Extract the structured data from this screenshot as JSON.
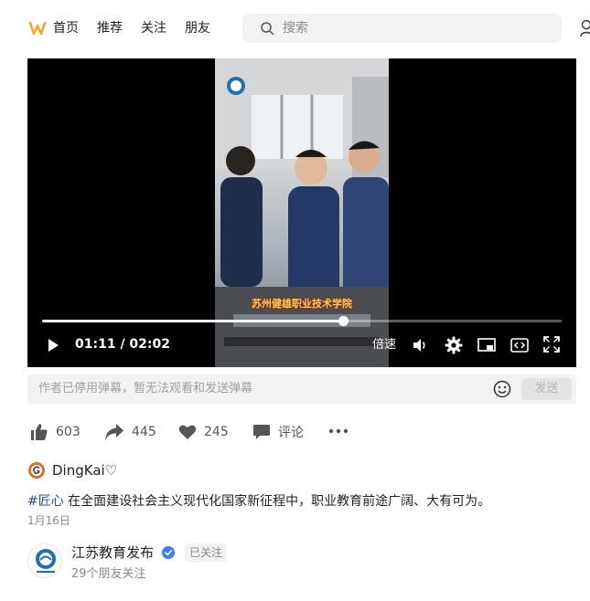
{
  "nav": {
    "items": [
      {
        "label": "首页"
      },
      {
        "label": "推荐"
      },
      {
        "label": "关注"
      },
      {
        "label": "朋友"
      }
    ],
    "search_placeholder": "搜索"
  },
  "player": {
    "subtitle": "苏州健雄职业技术学院",
    "current_time": "01:11",
    "total_time": "02:02",
    "time_display": "01:11 / 02:02",
    "progress": 0.58,
    "speed_label": "倍速"
  },
  "danmaku": {
    "notice": "作者已停用弹幕，暂无法观看和发送弹幕",
    "send_label": "发送"
  },
  "actions": {
    "likes": "603",
    "shares": "445",
    "favorites": "245",
    "comment_label": "评论"
  },
  "author": {
    "name": "DingKai♡"
  },
  "post": {
    "hashtag": "#匠心",
    "text": " 在全面建设社会主义现代化国家新征程中，职业教育前途广阔、大有可为。",
    "date": "1月16日"
  },
  "account": {
    "name": "江苏教育发布",
    "follow_status": "已关注",
    "friends_following": "29个朋友关注"
  },
  "colors": {
    "accent": "#f5a623",
    "hashtag": "#2a4f8f",
    "verified": "#3d7bf7"
  }
}
